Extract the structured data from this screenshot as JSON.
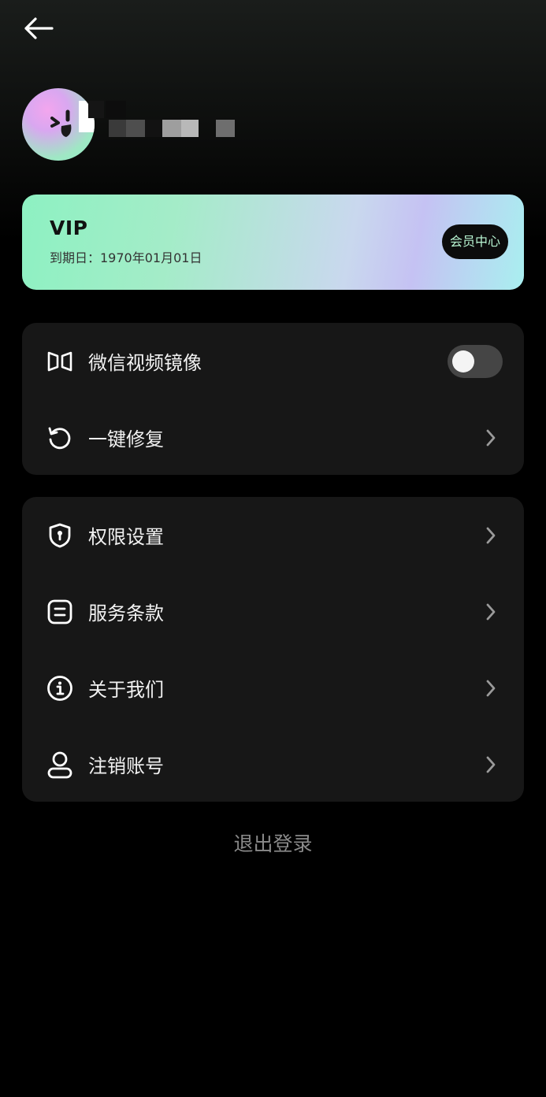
{
  "nav": {
    "back_icon": "arrow-left-icon"
  },
  "profile": {
    "avatar_icon": "smiley-avatar-icon",
    "username_redacted": true
  },
  "vip": {
    "title": "VIP",
    "expire_text": "到期日：1970年01月01日",
    "member_center_label": "会员中心"
  },
  "settings_group_1": [
    {
      "label": "微信视频镜像",
      "icon": "mirror-icon",
      "control": "toggle",
      "toggle_on": false
    },
    {
      "label": "一键修复",
      "icon": "refresh-icon",
      "control": "chevron"
    }
  ],
  "settings_group_2": [
    {
      "label": "权限设置",
      "icon": "shield-icon",
      "control": "chevron"
    },
    {
      "label": "服务条款",
      "icon": "document-icon",
      "control": "chevron"
    },
    {
      "label": "关于我们",
      "icon": "info-icon",
      "control": "chevron"
    },
    {
      "label": "注销账号",
      "icon": "user-icon",
      "control": "chevron"
    }
  ],
  "logout_label": "退出登录",
  "colors": {
    "background": "#000000",
    "card": "#171717",
    "vip_gradient_start": "#8df1c2",
    "vip_gradient_end": "#a9eff0",
    "member_button_text": "#b8f5d2",
    "logout_text": "#8a8a8a"
  }
}
